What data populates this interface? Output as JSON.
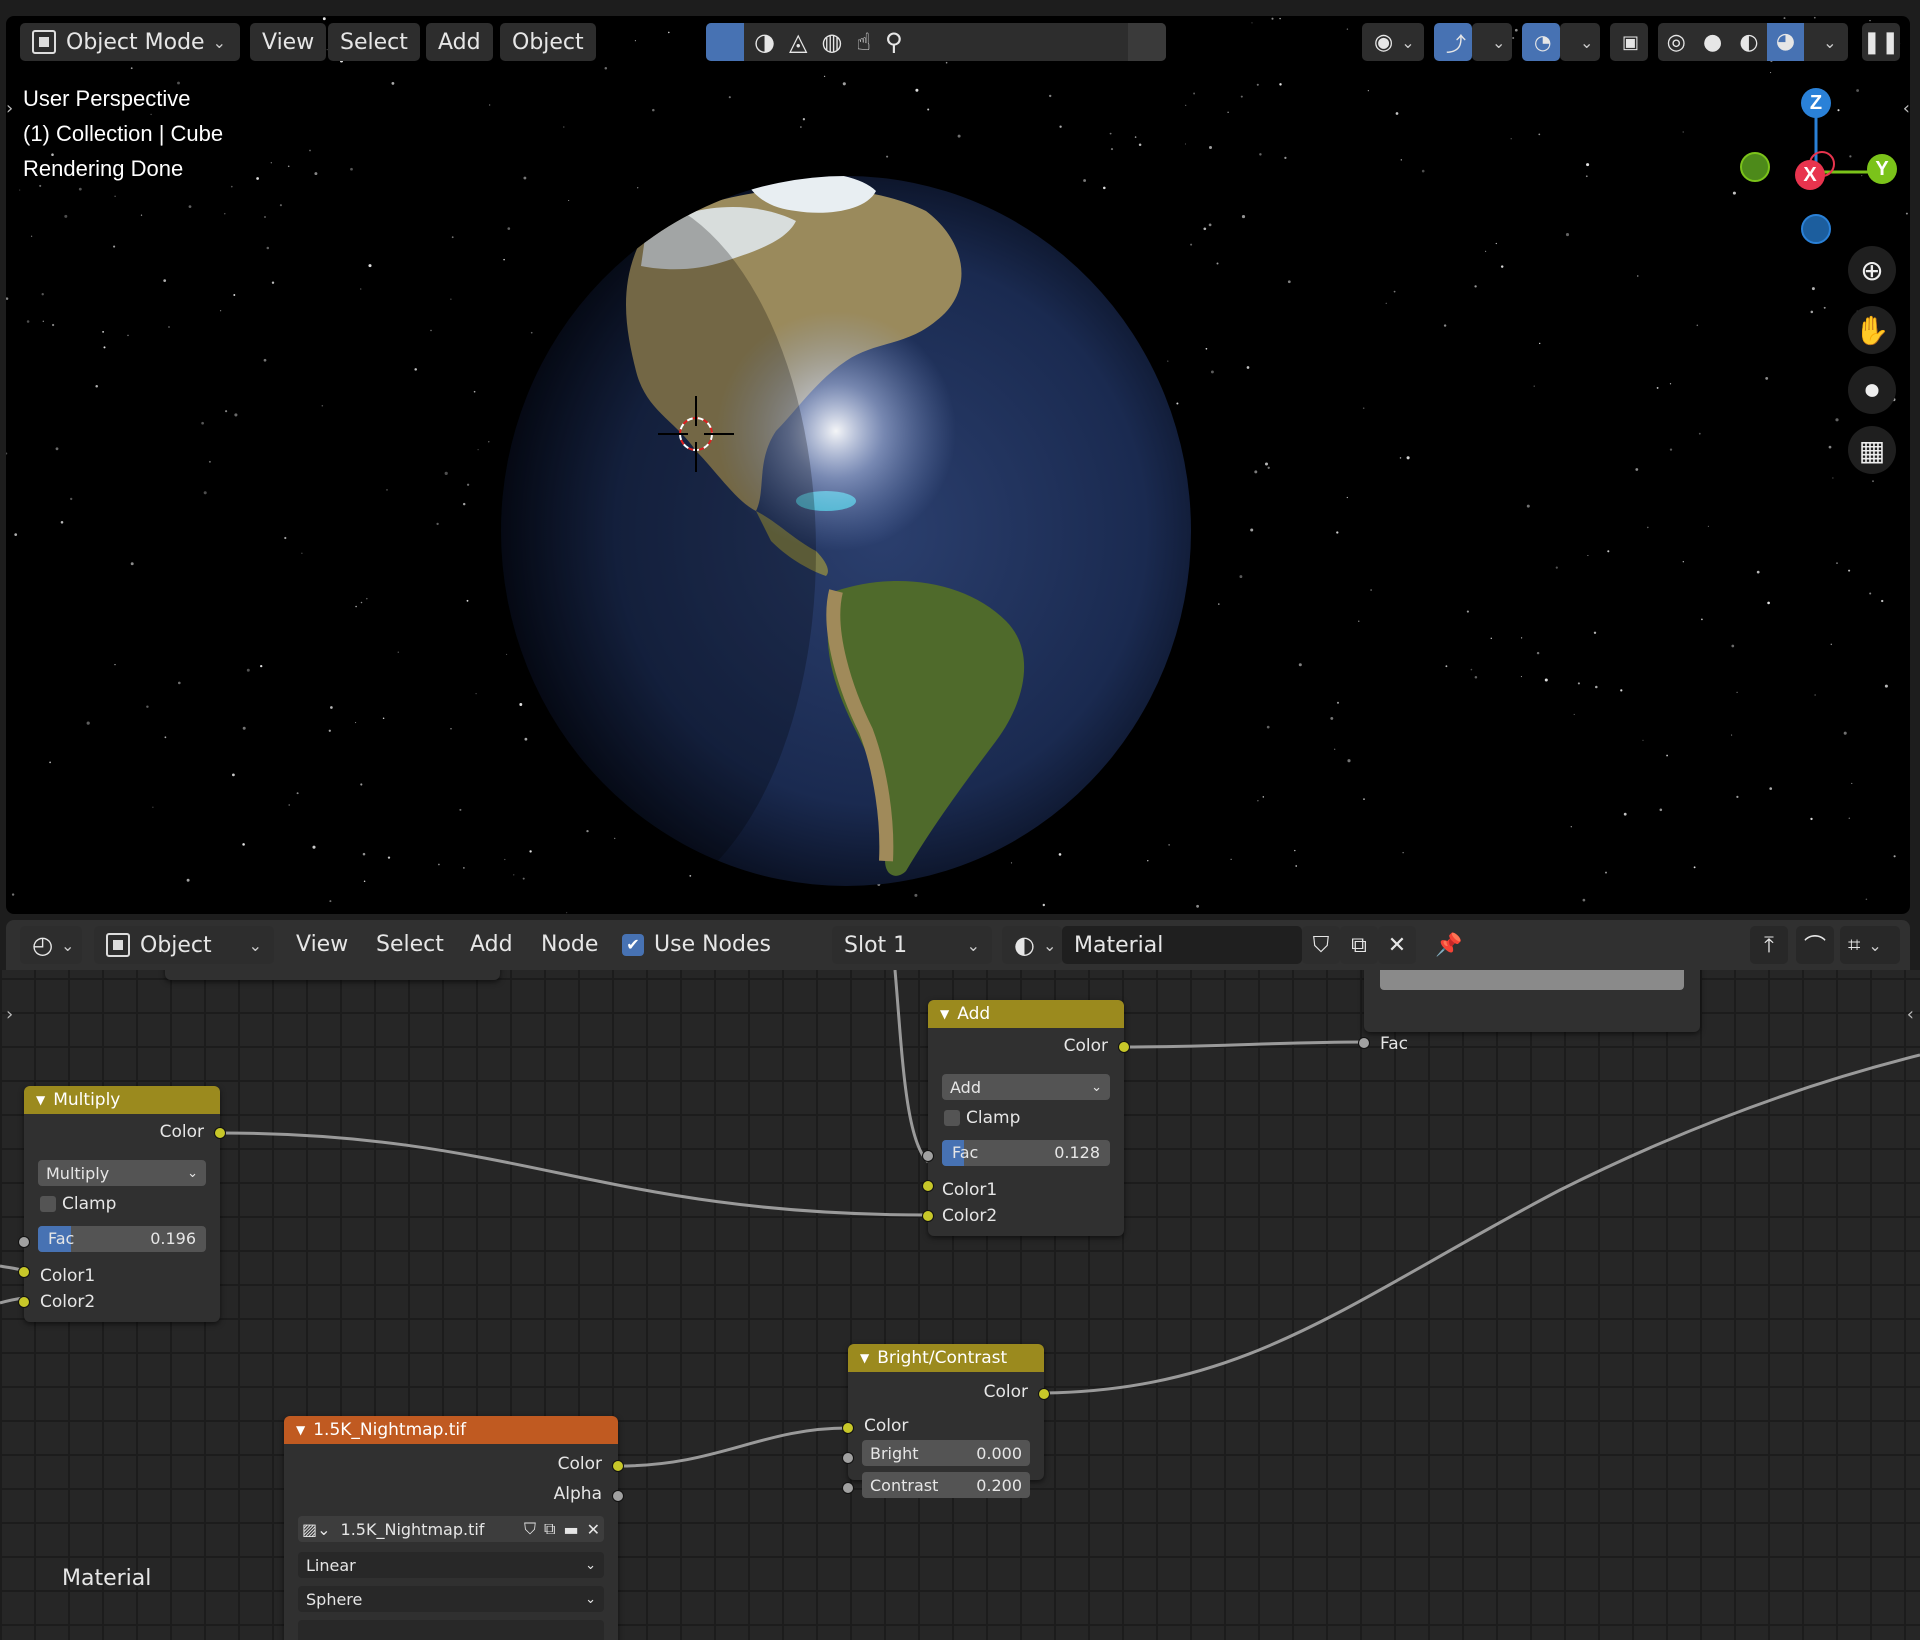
{
  "viewport": {
    "mode_label": "Object Mode",
    "menus": [
      "View",
      "Select",
      "Add",
      "Object"
    ],
    "overlay_lines": [
      "User Perspective",
      "(1) Collection | Cube",
      "Rendering Done"
    ],
    "axes": {
      "z": "Z",
      "x": "X",
      "y": "Y"
    },
    "nav_icons": [
      "zoom-icon",
      "hand-pan-icon",
      "camera-icon",
      "grid-ortho-icon"
    ]
  },
  "node_editor": {
    "type_label": "Object",
    "menus": [
      "View",
      "Select",
      "Add",
      "Node"
    ],
    "use_nodes_label": "Use Nodes",
    "use_nodes_checked": true,
    "slot_label": "Slot 1",
    "material_name": "Material",
    "region_label": "Material"
  },
  "nodes": {
    "add": {
      "title": "Add",
      "output_color": "Color",
      "blend_mode": "Add",
      "clamp_label": "Clamp",
      "fac_label": "Fac",
      "fac_value": "0.128",
      "fac_fraction": 0.128,
      "color1": "Color1",
      "color2": "Color2"
    },
    "multiply": {
      "title": "Multiply",
      "output_color": "Color",
      "blend_mode": "Multiply",
      "clamp_label": "Clamp",
      "fac_label": "Fac",
      "fac_value": "0.196",
      "fac_fraction": 0.196,
      "color1": "Color1",
      "color2": "Color2"
    },
    "top_right": {
      "fac_label": "Fac"
    },
    "bright_contrast": {
      "title": "Bright/Contrast",
      "output_color": "Color",
      "input_color": "Color",
      "bright_label": "Bright",
      "bright_value": "0.000",
      "contrast_label": "Contrast",
      "contrast_value": "0.200"
    },
    "image": {
      "title": "1.5K_Nightmap.tif",
      "output_color": "Color",
      "output_alpha": "Alpha",
      "image_name": "1.5K_Nightmap.tif",
      "interpolation": "Linear",
      "projection": "Sphere"
    }
  },
  "colors": {
    "node_header_mix": "#9b8a1e",
    "node_header_texture": "#c05a21",
    "accent_blue": "#4772b3",
    "socket_color": "#c7c729",
    "socket_float": "#a1a1a1"
  }
}
